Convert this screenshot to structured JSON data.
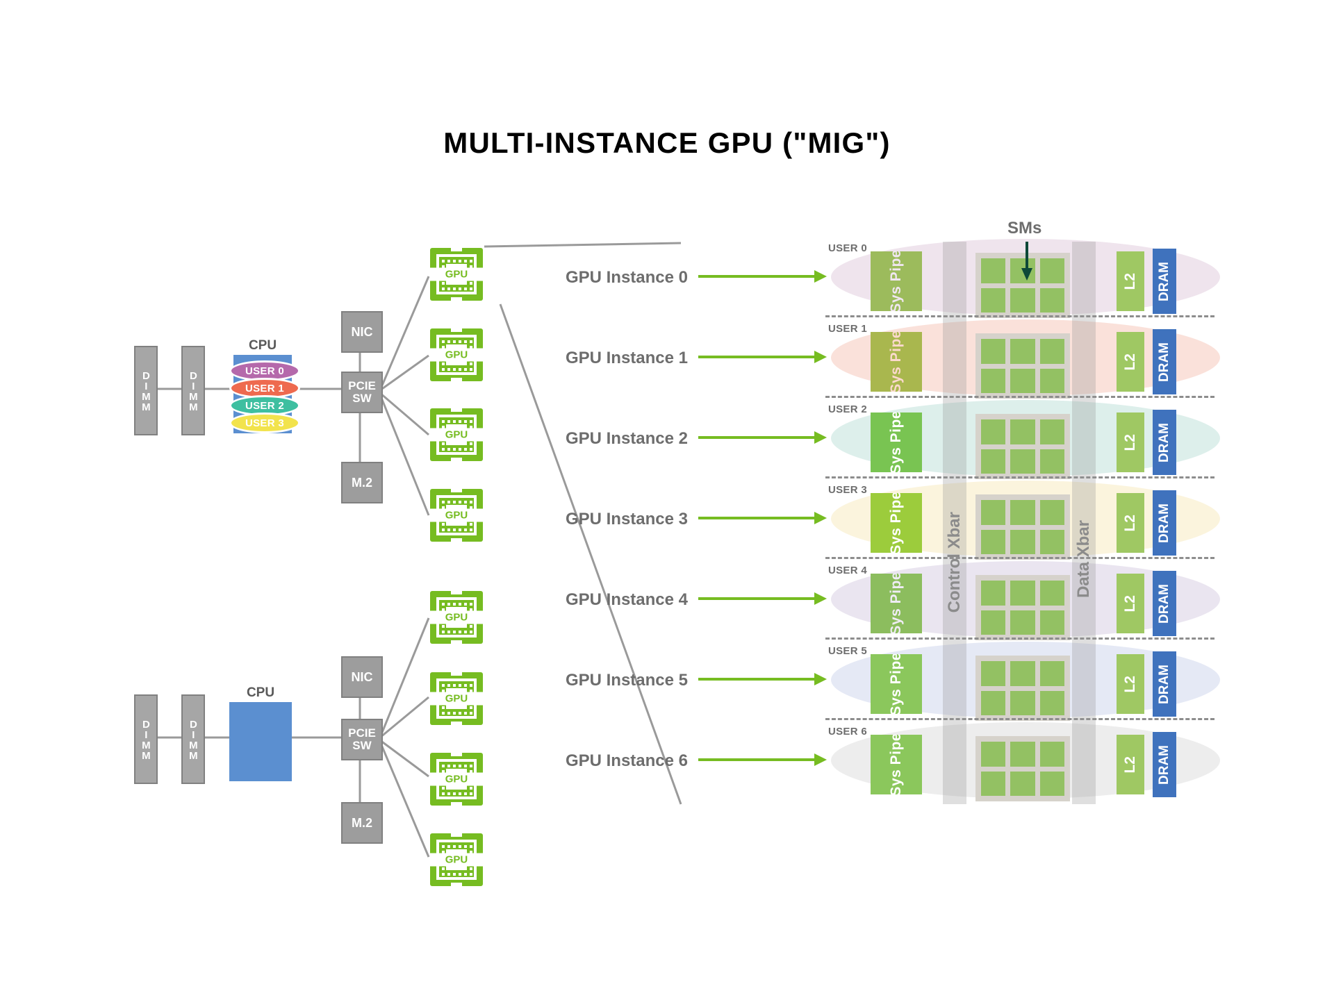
{
  "title": "MULTI-INSTANCE GPU (\"MIG\")",
  "labels": {
    "cpu": "CPU",
    "dimm": "DIMM",
    "nic": "NIC",
    "m2": "M.2",
    "pcie_sw": "PCIE\nSW",
    "pcie_sw_line1": "PCIE",
    "pcie_sw_line2": "SW",
    "gpu_chip": "GPU",
    "sms": "SMs",
    "control_xbar": "Control Xbar",
    "data_xbar": "Data Xbar",
    "sys_pipe_line1": "Sys",
    "sys_pipe_line2": "Pipe",
    "l2": "L2",
    "dram": "DRAM"
  },
  "colors": {
    "gpu_green": "#76bc21",
    "sm_green": "#93c163",
    "l2_green": "#9fc863",
    "dram_blue": "#3f72bd",
    "cpu_blue": "#5b8fd0",
    "box_grey": "#9d9d9d",
    "wire_grey": "#9a9a9a",
    "label_grey": "#6d6d6d",
    "arrow_green": "#76bc21",
    "sms_arrow": "#0d4938"
  },
  "top_system": {
    "dimms": [
      "DIMM",
      "DIMM"
    ],
    "cpu_label": "CPU",
    "users": [
      {
        "label": "USER 0",
        "color": "#b569ab"
      },
      {
        "label": "USER 1",
        "color": "#ee6a4f"
      },
      {
        "label": "USER 2",
        "color": "#3ebfa0"
      },
      {
        "label": "USER 3",
        "color": "#f2e34c"
      }
    ],
    "nic": "NIC",
    "m2": "M.2",
    "pcie": "PCIE SW",
    "gpus": [
      "GPU",
      "GPU",
      "GPU",
      "GPU"
    ]
  },
  "bottom_system": {
    "dimms": [
      "DIMM",
      "DIMM"
    ],
    "cpu_label": "CPU",
    "nic": "NIC",
    "m2": "M.2",
    "pcie": "PCIE SW",
    "gpus": [
      "GPU",
      "GPU",
      "GPU",
      "GPU"
    ]
  },
  "instances": [
    {
      "user": "USER 0",
      "gi": "GPU Instance 0",
      "tint": "#c9a6c4",
      "sys_pipe": "#9cbb5c",
      "sm_cols": 3,
      "sm_rows": 2,
      "pipe_text": "#f0e6f0"
    },
    {
      "user": "USER 1",
      "gi": "GPU Instance 1",
      "tint": "#ef9a84",
      "sys_pipe": "#a9b74e",
      "sm_cols": 3,
      "sm_rows": 2,
      "pipe_text": "#fbd9cd"
    },
    {
      "user": "USER 2",
      "gi": "GPU Instance 2",
      "tint": "#8ecbbe",
      "sys_pipe": "#79c452",
      "sm_cols": 3,
      "sm_rows": 2,
      "pipe_text": "#ffffff"
    },
    {
      "user": "USER 3",
      "gi": "GPU Instance 3",
      "tint": "#f2dc8e",
      "sys_pipe": "#9ccc3c",
      "sm_cols": 3,
      "sm_rows": 2,
      "pipe_text": "#ffffff"
    },
    {
      "user": "USER 4",
      "gi": "GPU Instance 4",
      "tint": "#b9a9cd",
      "sys_pipe": "#8cbd5e",
      "sm_cols": 3,
      "sm_rows": 2,
      "pipe_text": "#efecf4"
    },
    {
      "user": "USER 5",
      "gi": "GPU Instance 5",
      "tint": "#a9b6dd",
      "sys_pipe": "#8bc75c",
      "sm_cols": 3,
      "sm_rows": 2,
      "pipe_text": "#ffffff"
    },
    {
      "user": "USER 6",
      "gi": "GPU Instance 6",
      "tint": "#c2c2c2",
      "sys_pipe": "#8bc75c",
      "sm_cols": 3,
      "sm_rows": 2,
      "pipe_text": "#ffffff"
    }
  ]
}
